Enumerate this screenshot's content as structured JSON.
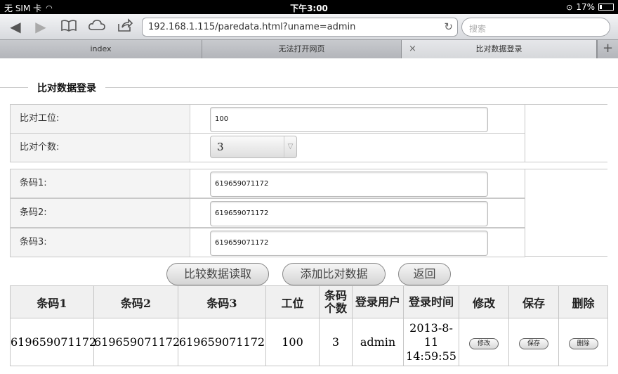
{
  "status": {
    "carrier": "无 SIM 卡",
    "time": "下午3:00",
    "battery": "17%",
    "battery_level": 0.17
  },
  "browser": {
    "url": "192.168.1.115/paredata.html?uname=admin",
    "search_placeholder": "搜索",
    "tabs": [
      {
        "label": "index"
      },
      {
        "label": "无法打开网页"
      },
      {
        "label": "比对数据登录",
        "close": "×"
      }
    ],
    "add_tab": "+"
  },
  "form": {
    "legend": "比对数据登录",
    "station_label": "比对工位:",
    "station_value": "100",
    "count_label": "比对个数:",
    "count_value": "3",
    "barcodes": [
      {
        "label": "条码1:",
        "value": "619659071172"
      },
      {
        "label": "条码2:",
        "value": "619659071172"
      },
      {
        "label": "条码3:",
        "value": "619659071172"
      }
    ]
  },
  "buttons": {
    "read": "比较数据读取",
    "add": "添加比对数据",
    "back": "返回"
  },
  "table": {
    "headers": [
      "条码1",
      "条码2",
      "条码3",
      "工位",
      "条码个数",
      "登录用户",
      "登录时间",
      "修改",
      "保存",
      "删除"
    ],
    "rows": [
      {
        "barcode1": "619659071172",
        "barcode2": "619659071172",
        "barcode3": "619659071172",
        "station": "100",
        "count": "3",
        "user": "admin",
        "time": "2013-8-11 14:59:55",
        "edit": "修改",
        "save": "保存",
        "delete": "删除"
      }
    ]
  }
}
